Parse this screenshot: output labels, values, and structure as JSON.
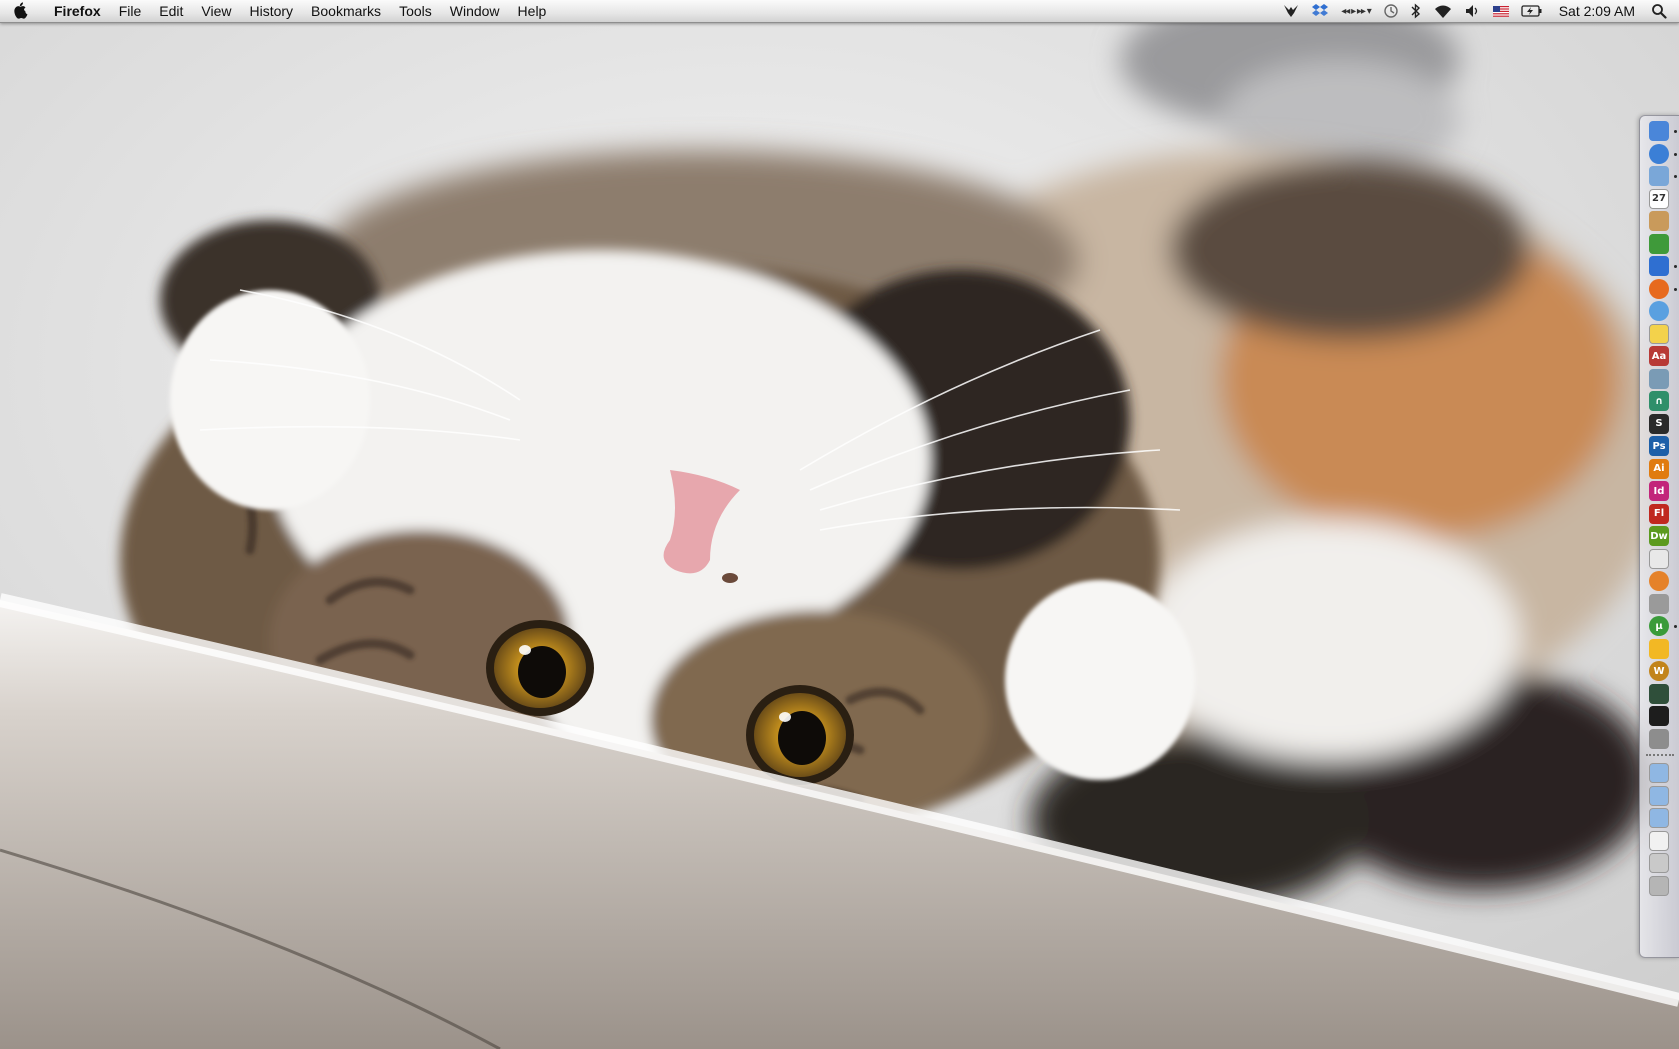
{
  "menubar": {
    "app_name": "Firefox",
    "menus": [
      "File",
      "Edit",
      "View",
      "History",
      "Bookmarks",
      "Tools",
      "Window",
      "Help"
    ],
    "clock": "Sat 2:09 AM",
    "status_icons": [
      "growl-icon",
      "dropbox-icon",
      "media-controls-icon",
      "time-machine-icon",
      "bluetooth-icon",
      "wifi-icon",
      "volume-icon",
      "us-flag-input-icon",
      "battery-icon",
      "spotlight-icon"
    ]
  },
  "dock": {
    "apps": [
      {
        "name": "finder-icon",
        "label": "",
        "color": "#4a86d9",
        "running": true
      },
      {
        "name": "itunes-icon",
        "label": "",
        "color": "#3b7fd6",
        "running": true
      },
      {
        "name": "mail-icon",
        "label": "",
        "color": "#7aa7d8",
        "running": true
      },
      {
        "name": "ical-icon",
        "label": "27",
        "color": "#ffffff",
        "running": false
      },
      {
        "name": "address-book-icon",
        "label": "",
        "color": "#c99a5b",
        "running": false
      },
      {
        "name": "tree-icon",
        "label": "",
        "color": "#3f9a3a",
        "running": false
      },
      {
        "name": "dropbox-icon",
        "label": "",
        "color": "#2f6fd1",
        "running": true
      },
      {
        "name": "firefox-icon",
        "label": "",
        "color": "#e76a1e",
        "running": true
      },
      {
        "name": "safari-icon",
        "label": "",
        "color": "#5aa0e0",
        "running": false
      },
      {
        "name": "stickies-icon",
        "label": "",
        "color": "#f3d24b",
        "running": false
      },
      {
        "name": "dictionary-icon",
        "label": "Aa",
        "color": "#b83a36",
        "running": false
      },
      {
        "name": "robot-icon",
        "label": "",
        "color": "#7a9bb5",
        "running": false
      },
      {
        "name": "magnet-icon",
        "label": "∩",
        "color": "#2f8f6a",
        "running": false
      },
      {
        "name": "skype-icon",
        "label": "S",
        "color": "#2a2a2a",
        "running": false
      },
      {
        "name": "photoshop-icon",
        "label": "Ps",
        "color": "#1d5fa8",
        "running": false
      },
      {
        "name": "illustrator-icon",
        "label": "Ai",
        "color": "#e07b10",
        "running": false
      },
      {
        "name": "indesign-icon",
        "label": "Id",
        "color": "#c2257a",
        "running": false
      },
      {
        "name": "flash-icon",
        "label": "Fl",
        "color": "#c0281f",
        "running": false
      },
      {
        "name": "dreamweaver-icon",
        "label": "Dw",
        "color": "#5c9a1f",
        "running": false
      },
      {
        "name": "acrobat-icon",
        "label": "",
        "color": "#e8e8e8",
        "running": false
      },
      {
        "name": "transmit-icon",
        "label": "",
        "color": "#e5822a",
        "running": false
      },
      {
        "name": "pen-tool-icon",
        "label": "",
        "color": "#9a9a9a",
        "running": false
      },
      {
        "name": "utorrent-icon",
        "label": "µ",
        "color": "#3a9b3a",
        "running": true
      },
      {
        "name": "adium-duck-icon",
        "label": "",
        "color": "#f2b824",
        "running": false
      },
      {
        "name": "wordpress-icon",
        "label": "W",
        "color": "#c2841a",
        "running": false
      },
      {
        "name": "activity-monitor-icon",
        "label": "",
        "color": "#2f4f3a",
        "running": false
      },
      {
        "name": "terminal-icon",
        "label": "",
        "color": "#1d1d1d",
        "running": false
      },
      {
        "name": "system-preferences-icon",
        "label": "",
        "color": "#8d8d8d",
        "running": false
      }
    ],
    "stacks": [
      {
        "name": "applications-folder-icon",
        "label": "",
        "color": "#8fb7e3"
      },
      {
        "name": "documents-folder-icon",
        "label": "",
        "color": "#8fb7e3"
      },
      {
        "name": "downloads-folder-icon",
        "label": "",
        "color": "#8fb7e3"
      },
      {
        "name": "document-stack-icon",
        "label": "",
        "color": "#f1f1f1"
      },
      {
        "name": "utilities-stack-icon",
        "label": "",
        "color": "#c9c9c9"
      },
      {
        "name": "trash-icon",
        "label": "",
        "color": "#b5b5b5"
      }
    ]
  },
  "wallpaper": {
    "subject": "kitten-lying-upside-down",
    "colors": {
      "background": "#dcdcdc",
      "fur_white": "#f3f2f0",
      "fur_tabby": "#6e5a44",
      "fur_dark": "#2a2420",
      "fur_ginger": "#c98a55",
      "eye_iris": "#b8871f",
      "nose": "#e7a7ad"
    }
  }
}
